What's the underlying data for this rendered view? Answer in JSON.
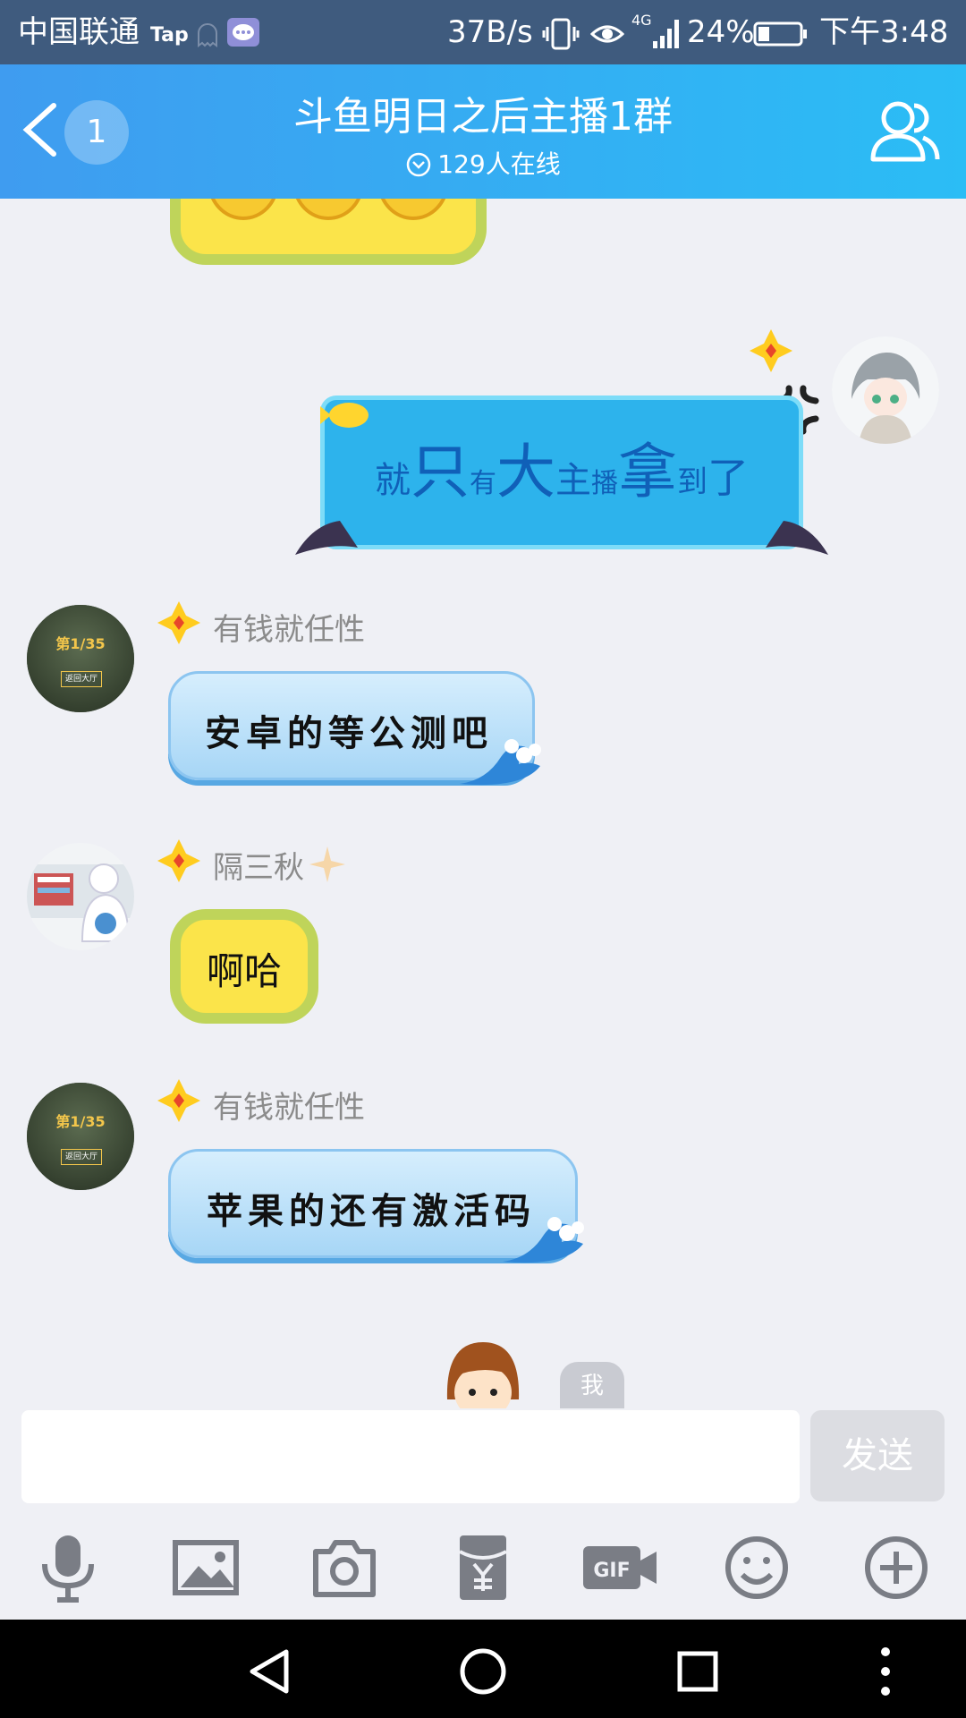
{
  "status_bar": {
    "carrier": "中国联通",
    "carrier_app": "Tap",
    "net_speed": "37B/s",
    "network": "4G",
    "battery": "24%",
    "time": "下午3:48"
  },
  "header": {
    "unread_count": "1",
    "title": "斗鱼明日之后主播1群",
    "online": "129人在线"
  },
  "messages": [
    {
      "sender": "",
      "self": true,
      "text": [
        "就",
        "只",
        "有",
        "大",
        "主",
        "播",
        "拿",
        "到",
        "了"
      ]
    },
    {
      "sender": "有钱就任性",
      "text": "安卓的等公测吧",
      "avatar_caption": "第1/35",
      "avatar_button": "返回大厅"
    },
    {
      "sender": "隔三秋",
      "text": "啊哈"
    },
    {
      "sender": "有钱就任性",
      "text": "苹果的还有激活码",
      "avatar_caption": "第1/35",
      "avatar_button": "返回大厅"
    }
  ],
  "me_tag": "我",
  "input": {
    "placeholder": "",
    "send_label": "发送"
  },
  "toolbar": [
    "microphone-icon",
    "image-icon",
    "camera-icon",
    "red-packet-icon",
    "gif-icon",
    "emoji-icon",
    "plus-icon"
  ],
  "toolbar_gif_label": "GIF",
  "colors": {
    "header_start": "#3f9cf0",
    "header_end": "#2bbdf5",
    "chat_bg": "#eff0f5",
    "status_bar": "#3f5b7e"
  }
}
